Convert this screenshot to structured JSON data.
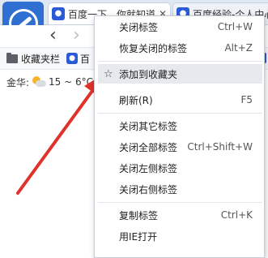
{
  "browser": {
    "tabs": [
      {
        "favicon": "paw-icon",
        "title": "百度一下，你就知道"
      },
      {
        "favicon": "paw-icon",
        "title": "百度经验-个人中心"
      }
    ],
    "favorites_bar": {
      "folder_label": "收藏夹栏",
      "item_label": "百"
    },
    "weather": {
      "city": "金华:",
      "temp": "15 ~ 6°C"
    }
  },
  "context_menu": {
    "items": [
      {
        "label": "关闭标签",
        "shortcut": "Ctrl+W"
      },
      {
        "label": "恢复关闭的标签",
        "shortcut": "Alt+Z"
      },
      {
        "label": "添加到收藏夹",
        "shortcut": "",
        "icon": "star-icon"
      },
      {
        "label": "刷新(R)",
        "shortcut": "F5"
      },
      {
        "label": "关闭其它标签",
        "shortcut": ""
      },
      {
        "label": "关闭全部标签",
        "shortcut": "Ctrl+Shift+W"
      },
      {
        "label": "关闭左侧标签",
        "shortcut": ""
      },
      {
        "label": "关闭右侧标签",
        "shortcut": ""
      },
      {
        "label": "复制标签",
        "shortcut": "Ctrl+K"
      },
      {
        "label": "用IE打开",
        "shortcut": ""
      }
    ]
  },
  "colors": {
    "annotation_arrow": "#e0312a",
    "accent": "#2f6fd1"
  }
}
